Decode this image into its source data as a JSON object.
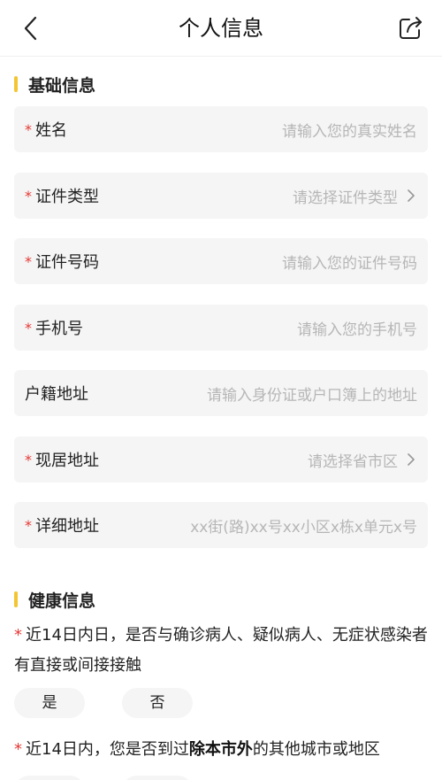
{
  "header": {
    "title": "个人信息",
    "back_icon": "back-arrow-icon",
    "share_icon": "share-icon"
  },
  "basic_section": {
    "title": "基础信息",
    "accent_color": "#f3c531"
  },
  "fields": [
    {
      "label": "姓名",
      "required": "*",
      "placeholder": "请输入您的真实姓名"
    },
    {
      "label": "证件类型",
      "required": "*",
      "placeholder": "请选择证件类型",
      "type": "select"
    },
    {
      "label": "证件号码",
      "required": "*",
      "placeholder": "请输入您的证件号码"
    },
    {
      "label": "手机号",
      "required": "*",
      "placeholder": "请输入您的手机号"
    },
    {
      "label": "户籍地址",
      "required": "",
      "placeholder": "请输入身份证或户口簿上的地址"
    },
    {
      "label": "现居地址",
      "required": "*",
      "placeholder": "请选择省市区",
      "type": "select"
    },
    {
      "label": "详细地址",
      "required": "*",
      "placeholder": "xx街(路)xx号xx小区x栋x单元x号"
    }
  ],
  "health_section": {
    "title": "健康信息"
  },
  "q1": {
    "required": "*",
    "text": "近14日内日，是否与确诊病人、疑似病人、无症状感染者有直接或间接接触",
    "options": [
      "是",
      "否"
    ]
  },
  "q2": {
    "required": "*",
    "text_before": "近14日内，您是否到过",
    "text_bold": "除本市外",
    "text_after": "的其他城市或地区"
  },
  "colors": {
    "required": "#e53935",
    "placeholder": "#b6b6b6",
    "field_bg": "#f5f5f5"
  }
}
